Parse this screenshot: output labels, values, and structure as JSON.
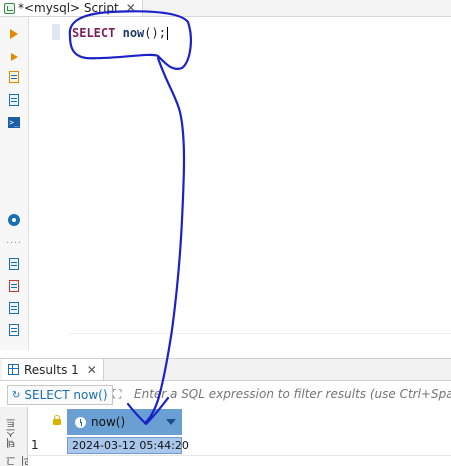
{
  "editor_tab": {
    "title": "*<mysql> Script",
    "close_label": "✕",
    "icon": "sql-script-icon"
  },
  "left_toolbar": {
    "icons": [
      "execute-statement-icon",
      "execute-script-icon",
      "execute-in-new-tab-icon",
      "explain-plan-icon",
      "terminal-icon",
      "settings-gear-icon",
      "more-icon",
      "export-icon",
      "import-icon",
      "variables-icon",
      "outline-icon"
    ]
  },
  "editor": {
    "keyword": "SELECT",
    "function": "now",
    "tail": "();"
  },
  "results": {
    "tab_label": "Results 1",
    "tab_close": "✕",
    "query_label": "SELECT now()",
    "filter_placeholder": "Enter a SQL expression to filter results (use Ctrl+Space)",
    "vertical_tabs": [
      "텍스트",
      "그리드"
    ],
    "columns": [
      "now()"
    ],
    "rows": [
      {
        "num": "1",
        "cells": [
          "2024-03-12 05:44:20"
        ]
      }
    ]
  },
  "colors": {
    "header_accent": "#6a9fd4",
    "selected_cell": "#a9c7ea",
    "annotation_ink": "#1a22c8"
  }
}
